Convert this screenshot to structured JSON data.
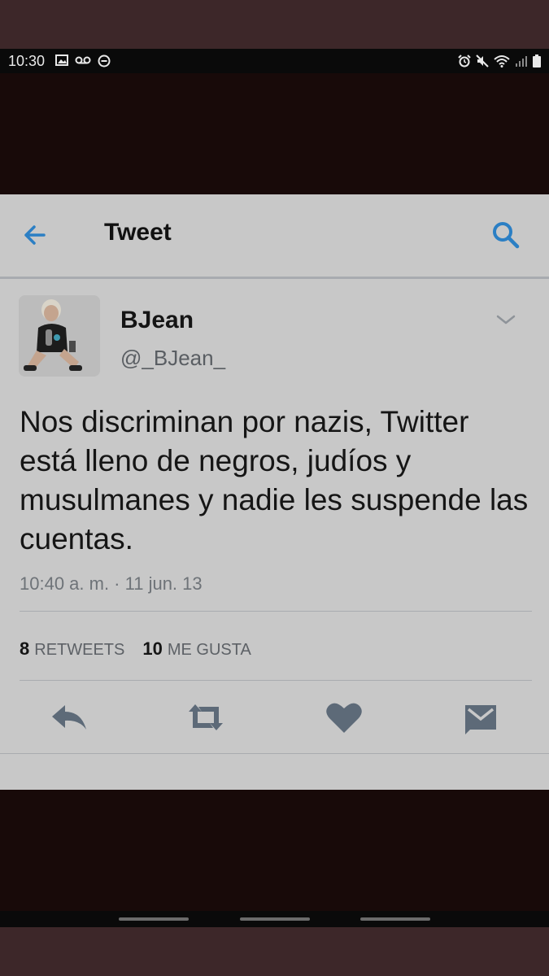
{
  "status_bar": {
    "time": "10:30",
    "left_icons": [
      "image-icon",
      "voicemail-icon",
      "do-not-disturb-icon"
    ],
    "right_icons": [
      "alarm-icon",
      "mute-icon",
      "wifi-icon",
      "signal-icon",
      "battery-icon"
    ]
  },
  "header": {
    "title": "Tweet",
    "accent_color": "#2b7fc4"
  },
  "tweet": {
    "display_name": "BJean",
    "handle": "@_BJean_",
    "text": "Nos discriminan por nazis, Twitter está lleno de negros, judíos y musulmanes y nadie les suspende las cuentas.",
    "timestamp": "10:40 a. m. · 11 jun. 13",
    "retweets_count": "8",
    "retweets_label": "RETWEETS",
    "likes_count": "10",
    "likes_label": "ME GUSTA"
  },
  "actions": [
    "reply-icon",
    "retweet-icon",
    "like-icon",
    "direct-message-icon"
  ]
}
